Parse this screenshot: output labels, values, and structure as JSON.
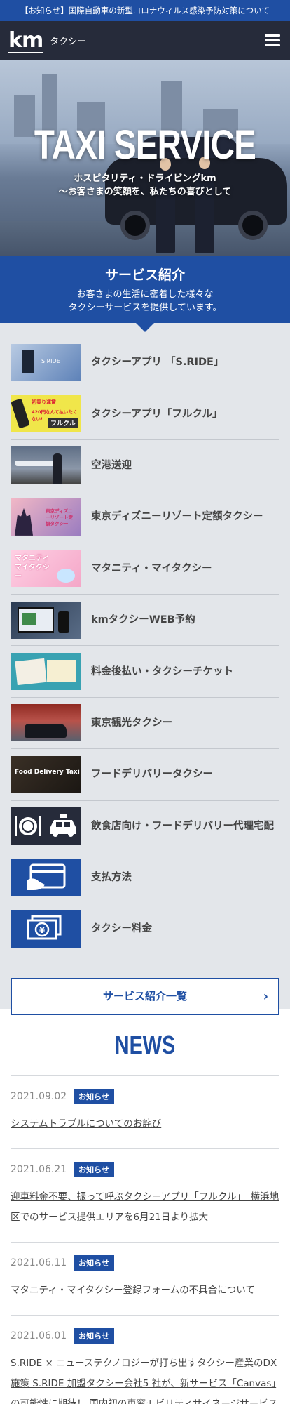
{
  "notice": "【お知らせ】国際自動車の新型コロナウィルス感染予防対策について",
  "header": {
    "logo": "km",
    "logo_sub": "タクシー"
  },
  "hero": {
    "title": "TAXI SERVICE",
    "subtitle_line1": "ホスピタリティ・ドライビングkm",
    "subtitle_line2": "〜お客さまの笑顔を、私たちの喜びとして"
  },
  "services": {
    "heading": "サービス紹介",
    "desc_line1": "お客さまの生活に密着した様々な",
    "desc_line2": "タクシーサービスを提供しています。",
    "items": [
      {
        "label": "タクシーアプリ 「S.RIDE」",
        "thumb": "S.RIDE"
      },
      {
        "label": "タクシーアプリ「フルクル」",
        "thumb_l1": "初乗り運賃",
        "thumb_l2": "420円なんて払いたくない!",
        "thumb_l3": "フルクル"
      },
      {
        "label": "空港送迎"
      },
      {
        "label": "東京ディズニーリゾート定額タクシー",
        "thumb": "東京ディズニーリゾート定額タクシー"
      },
      {
        "label": "マタニティ・マイタクシー",
        "thumb": "マタニティ マイタクシー"
      },
      {
        "label": "kmタクシーWEB予約"
      },
      {
        "label": "料金後払い・タクシーチケット"
      },
      {
        "label": "東京観光タクシー"
      },
      {
        "label": "フードデリバリータクシー",
        "thumb": "Food Delivery Taxi"
      },
      {
        "label": "飲食店向け・フードデリバリー代理宅配"
      },
      {
        "label": "支払方法"
      },
      {
        "label": "タクシー料金"
      }
    ],
    "more": "サービス紹介一覧",
    "more_chevron": "›"
  },
  "news": {
    "title": "NEWS",
    "items": [
      {
        "date": "2021.09.02",
        "tag": "お知らせ",
        "text": "システムトラブルについてのお詫び"
      },
      {
        "date": "2021.06.21",
        "tag": "お知らせ",
        "text": "迎車料金不要、振って呼ぶタクシーアプリ「フルクル」　横浜地区でのサービス提供エリアを6月21日より拡大"
      },
      {
        "date": "2021.06.11",
        "tag": "お知らせ",
        "text": "マタニティ・マイタクシー登録フォームの不具合について"
      },
      {
        "date": "2021.06.01",
        "tag": "お知らせ",
        "text": "S.RIDE × ニューステクノロジーが打ち出すタクシー産業のDX 施策 S.RIDE 加盟タクシー会社5 社が、新サービス「Canvas」の可能性に期待！ 国内初の車窓モビリティサイネージサービス「Canvas」全国出発式を開催 実車試験を行"
      }
    ]
  },
  "colors": {
    "brand_blue": "#1f4fa3",
    "header_dark": "#262b3a",
    "service_bg": "#e3e6ea"
  }
}
